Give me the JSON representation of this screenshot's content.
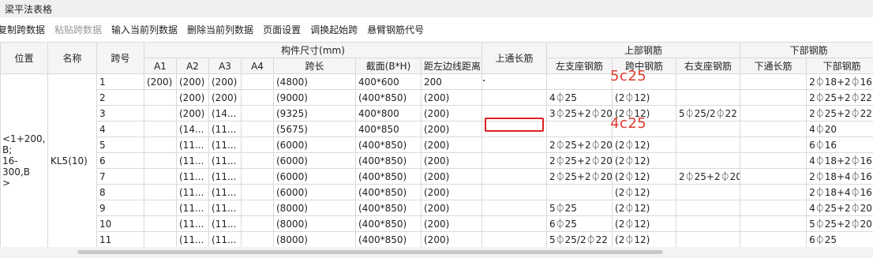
{
  "window": {
    "title": "梁平法表格"
  },
  "toolbar": {
    "items": [
      {
        "label": "复制跨数据",
        "disabled": false
      },
      {
        "label": "粘贴跨数据",
        "disabled": true
      },
      {
        "label": "输入当前列数据",
        "disabled": false
      },
      {
        "label": "删除当前列数据",
        "disabled": false
      },
      {
        "label": "页面设置",
        "disabled": false
      },
      {
        "label": "调换起始跨",
        "disabled": false
      },
      {
        "label": "悬臂钢筋代号",
        "disabled": false
      }
    ]
  },
  "table": {
    "group_headers": {
      "position": "位置",
      "name": "名称",
      "span_no": "跨号",
      "member_size": "构件尺寸(mm)",
      "top_through": "上通长筋",
      "top_rebar": "上部钢筋",
      "bottom_rebar": "下部钢筋"
    },
    "sub_headers": {
      "a1": "A1",
      "a2": "A2",
      "a3": "A3",
      "a4": "A4",
      "span_len": "跨长",
      "section": "截面(B*H)",
      "edge_dist": "距左边线距离",
      "left_support": "左支座钢筋",
      "mid_span": "跨中钢筋",
      "right_support": "右支座钢筋",
      "bottom_through": "下通长筋",
      "bottom": "下部钢筋"
    },
    "position_value": "<1+200,\nB;\n16-300,B\n>",
    "name_value": "KL5(10)",
    "rows": [
      {
        "span": "1",
        "a1": "(200)",
        "a2": "(200)",
        "a3": "(200)",
        "a4": "",
        "len": "(4800)",
        "sec": "400*600",
        "edge": "200",
        "top": "",
        "left": "",
        "mid": "",
        "right": "",
        "bthru": "",
        "bottom": "2⏀18+2⏀16"
      },
      {
        "span": "2",
        "a1": "",
        "a2": "(200)",
        "a3": "(200)",
        "a4": "",
        "len": "(9000)",
        "sec": "(400*850)",
        "edge": "(200)",
        "top": "",
        "left": "4⏀25",
        "mid": "(2⏀12)",
        "right": "",
        "bthru": "",
        "bottom": "2⏀25+2⏀22"
      },
      {
        "span": "3",
        "a1": "",
        "a2": "(200)",
        "a3": "(14...",
        "a4": "",
        "len": "(9325)",
        "sec": "400*800",
        "edge": "(200)",
        "top": "",
        "left": "3⏀25+2⏀20",
        "mid": "(2⏀12)",
        "right": "5⏀25/2⏀22",
        "bthru": "",
        "bottom": "2⏀25+2⏀22"
      },
      {
        "span": "4",
        "a1": "",
        "a2": "(14...",
        "a3": "(11...",
        "a4": "",
        "len": "(5675)",
        "sec": "400*850",
        "edge": "(200)",
        "top": "",
        "left": "",
        "mid": "",
        "right": "",
        "bthru": "",
        "bottom": "4⏀20"
      },
      {
        "span": "5",
        "a1": "",
        "a2": "(11...",
        "a3": "(11...",
        "a4": "",
        "len": "(6000)",
        "sec": "(400*850)",
        "edge": "(200)",
        "top": "",
        "left": "2⏀25+2⏀20",
        "mid": "(2⏀12)",
        "right": "",
        "bthru": "",
        "bottom": "6⏀16"
      },
      {
        "span": "6",
        "a1": "",
        "a2": "(11...",
        "a3": "(11...",
        "a4": "",
        "len": "(6000)",
        "sec": "(400*850)",
        "edge": "(200)",
        "top": "",
        "left": "2⏀25+2⏀20",
        "mid": "(2⏀12)",
        "right": "",
        "bthru": "",
        "bottom": "4⏀18+2⏀16"
      },
      {
        "span": "7",
        "a1": "",
        "a2": "(11...",
        "a3": "(11...",
        "a4": "",
        "len": "(6000)",
        "sec": "(400*850)",
        "edge": "(200)",
        "top": "",
        "left": "2⏀25+2⏀20",
        "mid": "(2⏀12)",
        "right": "2⏀25+2⏀20",
        "bthru": "",
        "bottom": "2⏀18+4⏀16"
      },
      {
        "span": "8",
        "a1": "",
        "a2": "(11...",
        "a3": "(11...",
        "a4": "",
        "len": "(6000)",
        "sec": "(400*850)",
        "edge": "(200)",
        "top": "",
        "left": "",
        "mid": "(2⏀12)",
        "right": "",
        "bthru": "",
        "bottom": "2⏀18+4⏀16"
      },
      {
        "span": "9",
        "a1": "",
        "a2": "(11...",
        "a3": "(11...",
        "a4": "",
        "len": "(8000)",
        "sec": "(400*850)",
        "edge": "(200)",
        "top": "",
        "left": "5⏀25",
        "mid": "(2⏀12)",
        "right": "",
        "bthru": "",
        "bottom": "4⏀25+2⏀20"
      },
      {
        "span": "10",
        "a1": "",
        "a2": "(11...",
        "a3": "(11...",
        "a4": "",
        "len": "(8000)",
        "sec": "(400*850)",
        "edge": "(200)",
        "top": "",
        "left": "6⏀25",
        "mid": "(2⏀12)",
        "right": "",
        "bthru": "",
        "bottom": "5⏀25+2⏀20"
      },
      {
        "span": "11",
        "a1": "",
        "a2": "(11...",
        "a3": "(11...",
        "a4": "",
        "len": "(8000)",
        "sec": "(400*850)",
        "edge": "(200)",
        "top": "",
        "left": "5⏀25/2⏀22",
        "mid": "(2⏀12)",
        "right": "",
        "bthru": "",
        "bottom": "6⏀25"
      }
    ]
  },
  "annotations": {
    "first": "5c25",
    "second": "4c25",
    "color": "#e03b2f"
  }
}
